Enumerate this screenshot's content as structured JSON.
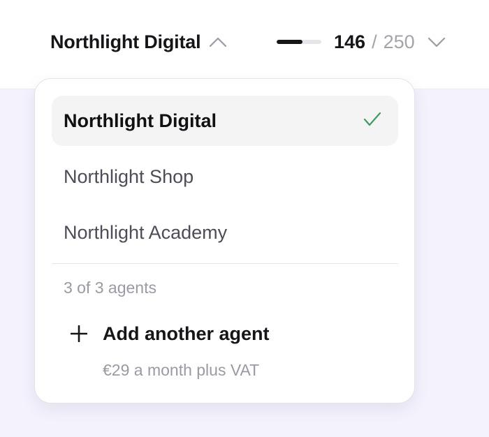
{
  "header": {
    "workspace_name": "Northlight Digital",
    "usage": {
      "used": "146",
      "separator": "/",
      "limit": "250",
      "fraction": 0.584
    }
  },
  "dropdown": {
    "options": [
      {
        "label": "Northlight Digital",
        "selected": true
      },
      {
        "label": "Northlight Shop",
        "selected": false
      },
      {
        "label": "Northlight Academy",
        "selected": false
      }
    ],
    "agents_count": "3 of 3 agents",
    "add_agent_label": "Add another agent",
    "price_note": "€29 a month plus VAT"
  },
  "icons": {
    "switcher": "chevron-up-icon",
    "usage": "chevron-down-icon",
    "selected": "check-icon",
    "add": "plus-icon"
  },
  "colors": {
    "accent_check": "#3e9a65",
    "page_background": "#f4f2fd",
    "selected_row": "#f4f4f5",
    "usage_fill": "#151518",
    "usage_track": "#e6e6ea"
  }
}
